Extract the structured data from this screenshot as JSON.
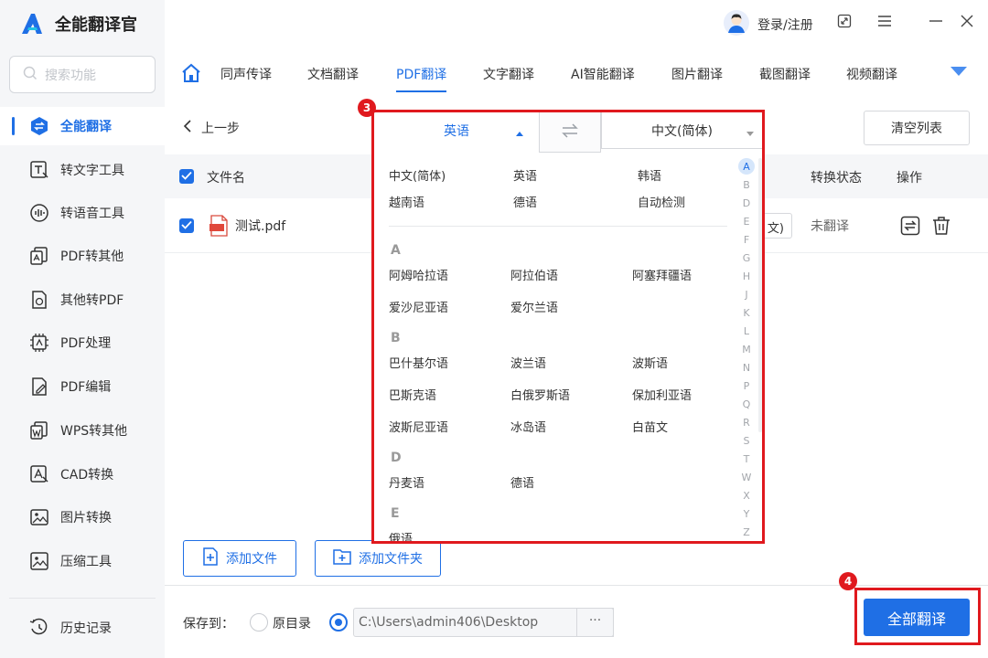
{
  "app": {
    "title": "全能翻译官"
  },
  "search": {
    "placeholder": "搜索功能"
  },
  "sidebar": {
    "items": [
      {
        "label": "全能翻译",
        "icon": "translate-icon",
        "active": true
      },
      {
        "label": "转文字工具",
        "icon": "text-tool-icon"
      },
      {
        "label": "转语音工具",
        "icon": "voice-tool-icon"
      },
      {
        "label": "PDF转其他",
        "icon": "pdf-export-icon"
      },
      {
        "label": "其他转PDF",
        "icon": "pdf-import-icon"
      },
      {
        "label": "PDF处理",
        "icon": "pdf-process-icon"
      },
      {
        "label": "PDF编辑",
        "icon": "pdf-edit-icon"
      },
      {
        "label": "WPS转其他",
        "icon": "wps-icon"
      },
      {
        "label": "CAD转换",
        "icon": "cad-icon"
      },
      {
        "label": "图片转换",
        "icon": "image-icon"
      },
      {
        "label": "压缩工具",
        "icon": "compress-icon"
      }
    ],
    "history": "历史记录"
  },
  "topbar": {
    "user": "登录/注册"
  },
  "tabs": [
    {
      "label": "同声传译"
    },
    {
      "label": "文档翻译"
    },
    {
      "label": "PDF翻译",
      "active": true
    },
    {
      "label": "文字翻译"
    },
    {
      "label": "AI智能翻译"
    },
    {
      "label": "图片翻译"
    },
    {
      "label": "截图翻译"
    },
    {
      "label": "视频翻译"
    }
  ],
  "toolbar": {
    "back": "上一步",
    "clear": "清空列表"
  },
  "table": {
    "headers": {
      "filename": "文件名",
      "status": "转换状态",
      "action": "操作"
    },
    "rows": [
      {
        "filename": "测试.pdf",
        "lang_fragment": "文)",
        "status": "未翻译"
      }
    ]
  },
  "buttons": {
    "add_file": "添加文件",
    "add_folder": "添加文件夹",
    "translate_all": "全部翻译"
  },
  "footer": {
    "save_to": "保存到：",
    "original_dir": "原目录",
    "path": "C:\\Users\\admin406\\Desktop",
    "browse": "···"
  },
  "badges": {
    "dropdown": "3",
    "translate": "4"
  },
  "dropdown": {
    "source": "英语",
    "target": "中文(简体)",
    "common": [
      "中文(简体)",
      "英语",
      "韩语",
      "越南语",
      "德语",
      "自动检测"
    ],
    "groups": [
      {
        "letter": "A",
        "items": [
          "阿姆哈拉语",
          "阿拉伯语",
          "阿塞拜疆语",
          "爱沙尼亚语",
          "爱尔兰语"
        ]
      },
      {
        "letter": "B",
        "items": [
          "巴什基尔语",
          "波兰语",
          "波斯语",
          "巴斯克语",
          "白俄罗斯语",
          "保加利亚语",
          "波斯尼亚语",
          "冰岛语",
          "白苗文"
        ]
      },
      {
        "letter": "D",
        "items": [
          "丹麦语",
          "德语"
        ]
      },
      {
        "letter": "E",
        "items": [
          "俄语"
        ]
      }
    ],
    "alphabet": [
      "A",
      "B",
      "D",
      "E",
      "F",
      "G",
      "H",
      "J",
      "K",
      "L",
      "M",
      "N",
      "P",
      "Q",
      "R",
      "S",
      "T",
      "W",
      "X",
      "Y",
      "Z"
    ],
    "active_letter": "A"
  },
  "colors": {
    "accent": "#1f6fe5",
    "highlight": "#e0191e"
  }
}
